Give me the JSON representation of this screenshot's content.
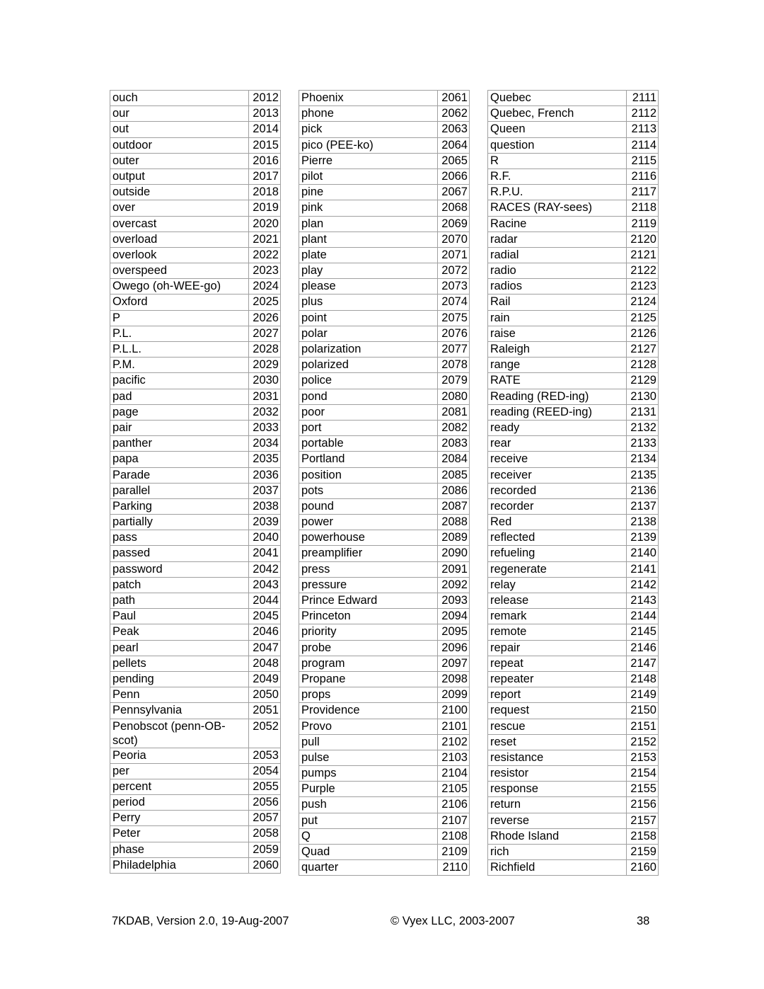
{
  "tables": [
    {
      "rows": [
        [
          "ouch",
          "2012"
        ],
        [
          "our",
          "2013"
        ],
        [
          "out",
          "2014"
        ],
        [
          "outdoor",
          "2015"
        ],
        [
          "outer",
          "2016"
        ],
        [
          "output",
          "2017"
        ],
        [
          "outside",
          "2018"
        ],
        [
          "over",
          "2019"
        ],
        [
          "overcast",
          "2020"
        ],
        [
          "overload",
          "2021"
        ],
        [
          "overlook",
          "2022"
        ],
        [
          "overspeed",
          "2023"
        ],
        [
          "Owego (oh-WEE-go)",
          "2024"
        ],
        [
          "Oxford",
          "2025"
        ],
        [
          "P",
          "2026"
        ],
        [
          "P.L.",
          "2027"
        ],
        [
          "P.L.L.",
          "2028"
        ],
        [
          "P.M.",
          "2029"
        ],
        [
          "pacific",
          "2030"
        ],
        [
          "pad",
          "2031"
        ],
        [
          "page",
          "2032"
        ],
        [
          "pair",
          "2033"
        ],
        [
          "panther",
          "2034"
        ],
        [
          "papa",
          "2035"
        ],
        [
          "Parade",
          "2036"
        ],
        [
          "parallel",
          "2037"
        ],
        [
          "Parking",
          "2038"
        ],
        [
          "partially",
          "2039"
        ],
        [
          "pass",
          "2040"
        ],
        [
          "passed",
          "2041"
        ],
        [
          "password",
          "2042"
        ],
        [
          "patch",
          "2043"
        ],
        [
          "path",
          "2044"
        ],
        [
          "Paul",
          "2045"
        ],
        [
          "Peak",
          "2046"
        ],
        [
          "pearl",
          "2047"
        ],
        [
          "pellets",
          "2048"
        ],
        [
          "pending",
          "2049"
        ],
        [
          "Penn",
          "2050"
        ],
        [
          "Pennsylvania",
          "2051"
        ],
        [
          "Penobscot (penn-OB-scot)",
          "2052"
        ],
        [
          "Peoria",
          "2053"
        ],
        [
          "per",
          "2054"
        ],
        [
          "percent",
          "2055"
        ],
        [
          "period",
          "2056"
        ],
        [
          "Perry",
          "2057"
        ],
        [
          "Peter",
          "2058"
        ],
        [
          "phase",
          "2059"
        ],
        [
          "Philadelphia",
          "2060"
        ]
      ]
    },
    {
      "rows": [
        [
          "Phoenix",
          "2061"
        ],
        [
          "phone",
          "2062"
        ],
        [
          "pick",
          "2063"
        ],
        [
          "pico (PEE-ko)",
          "2064"
        ],
        [
          "Pierre",
          "2065"
        ],
        [
          "pilot",
          "2066"
        ],
        [
          "pine",
          "2067"
        ],
        [
          "pink",
          "2068"
        ],
        [
          "plan",
          "2069"
        ],
        [
          "plant",
          "2070"
        ],
        [
          "plate",
          "2071"
        ],
        [
          "play",
          "2072"
        ],
        [
          "please",
          "2073"
        ],
        [
          "plus",
          "2074"
        ],
        [
          "point",
          "2075"
        ],
        [
          "polar",
          "2076"
        ],
        [
          "polarization",
          "2077"
        ],
        [
          "polarized",
          "2078"
        ],
        [
          "police",
          "2079"
        ],
        [
          "pond",
          "2080"
        ],
        [
          "poor",
          "2081"
        ],
        [
          "port",
          "2082"
        ],
        [
          "portable",
          "2083"
        ],
        [
          "Portland",
          "2084"
        ],
        [
          "position",
          "2085"
        ],
        [
          "pots",
          "2086"
        ],
        [
          "pound",
          "2087"
        ],
        [
          "power",
          "2088"
        ],
        [
          "powerhouse",
          "2089"
        ],
        [
          "preamplifier",
          "2090"
        ],
        [
          "press",
          "2091"
        ],
        [
          "pressure",
          "2092"
        ],
        [
          "Prince Edward",
          "2093"
        ],
        [
          "Princeton",
          "2094"
        ],
        [
          "priority",
          "2095"
        ],
        [
          "probe",
          "2096"
        ],
        [
          "program",
          "2097"
        ],
        [
          "Propane",
          "2098"
        ],
        [
          "props",
          "2099"
        ],
        [
          "Providence",
          "2100"
        ],
        [
          "Provo",
          "2101"
        ],
        [
          "pull",
          "2102"
        ],
        [
          "pulse",
          "2103"
        ],
        [
          "pumps",
          "2104"
        ],
        [
          "Purple",
          "2105"
        ],
        [
          "push",
          "2106"
        ],
        [
          "put",
          "2107"
        ],
        [
          "Q",
          "2108"
        ],
        [
          "Quad",
          "2109"
        ],
        [
          "quarter",
          "2110"
        ]
      ]
    },
    {
      "rows": [
        [
          "Quebec",
          "2111"
        ],
        [
          "Quebec, French",
          "2112"
        ],
        [
          "Queen",
          "2113"
        ],
        [
          "question",
          "2114"
        ],
        [
          "R",
          "2115"
        ],
        [
          "R.F.",
          "2116"
        ],
        [
          "R.P.U.",
          "2117"
        ],
        [
          "RACES (RAY-sees)",
          "2118"
        ],
        [
          "Racine",
          "2119"
        ],
        [
          "radar",
          "2120"
        ],
        [
          "radial",
          "2121"
        ],
        [
          "radio",
          "2122"
        ],
        [
          "radios",
          "2123"
        ],
        [
          "Rail",
          "2124"
        ],
        [
          "rain",
          "2125"
        ],
        [
          "raise",
          "2126"
        ],
        [
          "Raleigh",
          "2127"
        ],
        [
          "range",
          "2128"
        ],
        [
          "RATE",
          "2129"
        ],
        [
          "Reading (RED-ing)",
          "2130"
        ],
        [
          "reading (REED-ing)",
          "2131"
        ],
        [
          "ready",
          "2132"
        ],
        [
          "rear",
          "2133"
        ],
        [
          "receive",
          "2134"
        ],
        [
          "receiver",
          "2135"
        ],
        [
          "recorded",
          "2136"
        ],
        [
          "recorder",
          "2137"
        ],
        [
          "Red",
          "2138"
        ],
        [
          "reflected",
          "2139"
        ],
        [
          "refueling",
          "2140"
        ],
        [
          "regenerate",
          "2141"
        ],
        [
          "relay",
          "2142"
        ],
        [
          "release",
          "2143"
        ],
        [
          "remark",
          "2144"
        ],
        [
          "remote",
          "2145"
        ],
        [
          "repair",
          "2146"
        ],
        [
          "repeat",
          "2147"
        ],
        [
          "repeater",
          "2148"
        ],
        [
          "report",
          "2149"
        ],
        [
          "request",
          "2150"
        ],
        [
          "rescue",
          "2151"
        ],
        [
          "reset",
          "2152"
        ],
        [
          "resistance",
          "2153"
        ],
        [
          "resistor",
          "2154"
        ],
        [
          "response",
          "2155"
        ],
        [
          "return",
          "2156"
        ],
        [
          "reverse",
          "2157"
        ],
        [
          "Rhode Island",
          "2158"
        ],
        [
          "rich",
          "2159"
        ],
        [
          "Richfield",
          "2160"
        ]
      ]
    }
  ],
  "footer": {
    "left": "7KDAB, Version 2.0, 19-Aug-2007",
    "center": "© Vyex LLC, 2003-2007",
    "page_number": "38"
  }
}
